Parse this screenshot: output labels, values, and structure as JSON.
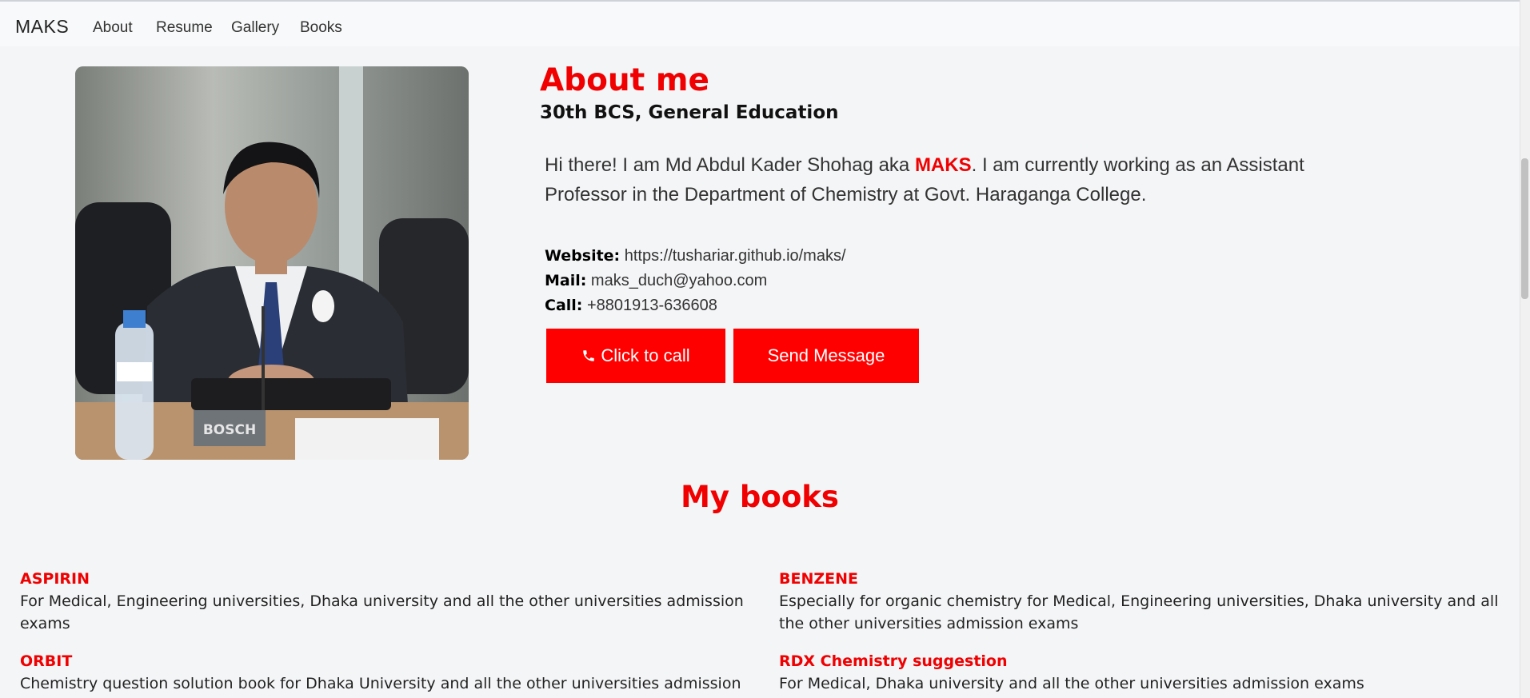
{
  "navbar": {
    "brand": "MAKS",
    "links": [
      "About",
      "Resume",
      "Gallery",
      "Books"
    ]
  },
  "about": {
    "title": "About me",
    "subtitle": "30th BCS, General Education",
    "intro_before": "Hi there! I am Md Abdul Kader Shohag aka ",
    "intro_highlight": "MAKS",
    "intro_after": ". I am currently working as an Assistant Professor in the Department of Chemistry at Govt. Haraganga College.",
    "website_label": "Website:",
    "website_value": "https://tushariar.github.io/maks/",
    "mail_label": "Mail:",
    "mail_value": "maks_duch@yahoo.com",
    "call_label": "Call:",
    "call_value": "+8801913-636608",
    "call_button": "Click to call",
    "message_button": "Send Message",
    "photo_alt": "Profile photo"
  },
  "books": {
    "title": "My books",
    "items": [
      {
        "title": "ASPIRIN",
        "desc": "For Medical, Engineering universities, Dhaka university and all the other universities admission exams"
      },
      {
        "title": "BENZENE",
        "desc": "Especially for organic chemistry for Medical, Engineering universities, Dhaka university and all the other universities admission exams"
      },
      {
        "title": "ORBIT",
        "desc": "Chemistry question solution book for Dhaka University and all the other universities admission"
      },
      {
        "title": "RDX Chemistry suggestion",
        "desc": "For Medical, Dhaka university and all the other universities admission exams"
      }
    ]
  },
  "colors": {
    "accent": "#ff0000",
    "background": "#f4f5f7",
    "navbar": "#f8f9fa"
  },
  "icons": {
    "call_button_icon": "phone-icon"
  }
}
